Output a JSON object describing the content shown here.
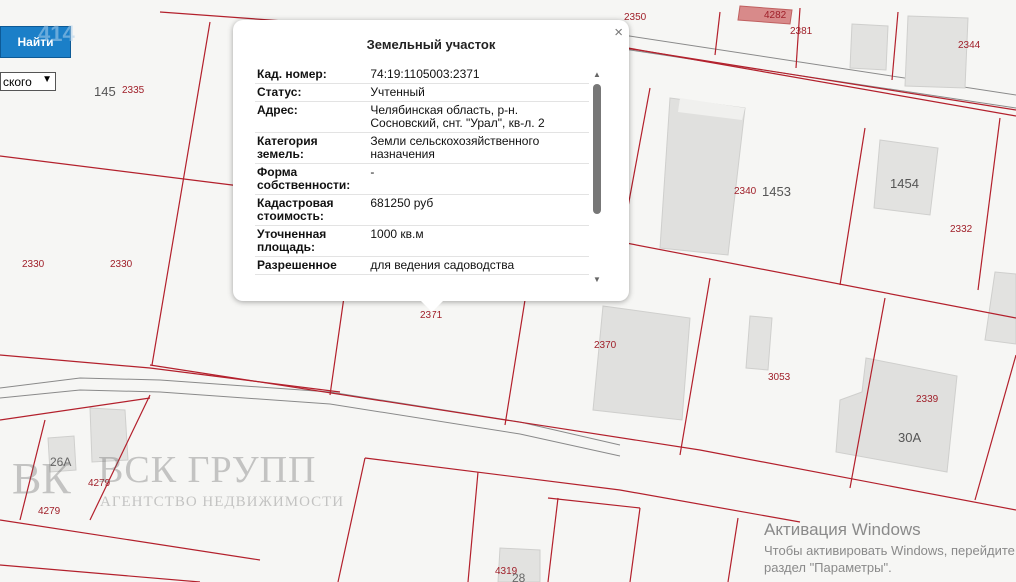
{
  "toolbar": {
    "search_label": "Найти",
    "select_value": "ского",
    "map_code": "414"
  },
  "popup": {
    "title": "Земельный участок",
    "close_glyph": "×",
    "rows": [
      {
        "label": "Кад. номер:",
        "value": "74:19:1105003:2371"
      },
      {
        "label": "Статус:",
        "value": "Учтенный"
      },
      {
        "label": "Адрес:",
        "value": "Челябинская область, р-н. Сосновский, снт. \"Урал\", кв-л. 2"
      },
      {
        "label": "Категория земель:",
        "value": "Земли сельскохозяйственного назначения"
      },
      {
        "label": "Форма собственности:",
        "value": "-"
      },
      {
        "label": "Кадастровая стоимость:",
        "value": "681250 руб"
      },
      {
        "label": "Уточненная площадь:",
        "value": "1000 кв.м"
      },
      {
        "label": "Разрешенное",
        "value": "для ведения садоводства"
      }
    ]
  },
  "map": {
    "plot_labels": [
      "2350",
      "2381",
      "4282",
      "2344",
      "2335",
      "2340",
      "2332",
      "2330",
      "2330",
      "2371",
      "2370",
      "3053",
      "2339",
      "4279",
      "4279",
      "4319"
    ],
    "building_labels": [
      "1453",
      "1454",
      "30А",
      "26А",
      "28"
    ],
    "partial_label": "145",
    "colors": {
      "background": "#f6f6f4",
      "plot_border": "#b3202c",
      "building_fill": "#e0e0de",
      "building_top": "#f0f0ee",
      "road_line": "#8a8a8a"
    }
  },
  "watermark": {
    "logo": "ВК",
    "name": "ВСК ГРУПП",
    "subtitle": "АГЕНТСТВО НЕДВИЖИМОСТИ"
  },
  "windows_activation": {
    "title": "Активация Windows",
    "line1": "Чтобы активировать Windows, перейдите в",
    "line2": "раздел \"Параметры\"."
  }
}
